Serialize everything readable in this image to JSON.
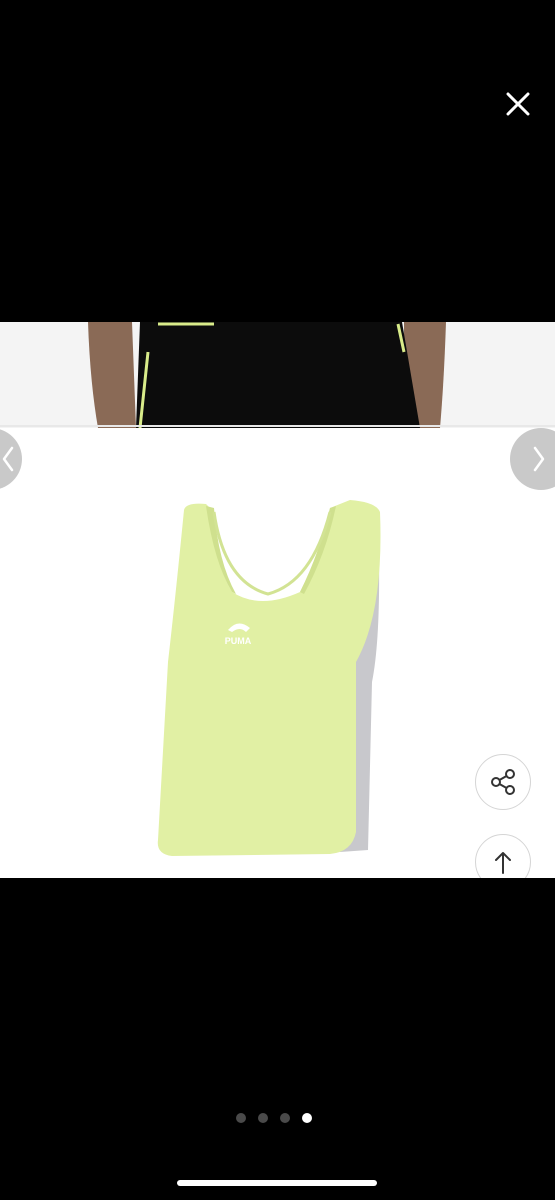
{
  "viewer": {
    "close_icon": "close-icon",
    "prev_icon": "chevron-left-icon",
    "next_icon": "chevron-right-icon",
    "share_icon": "share-icon",
    "scroll_top_icon": "arrow-up-icon"
  },
  "product_image": {
    "garment_color": "#e1f0a4",
    "logo_text": "PUMA"
  },
  "pagination": {
    "total": 4,
    "current": 4
  },
  "colors": {
    "background": "#000000",
    "photo_background": "#ffffff",
    "button_gray": "#c9c9c9",
    "dot_inactive": "#4a4a4a",
    "dot_active": "#ffffff"
  }
}
